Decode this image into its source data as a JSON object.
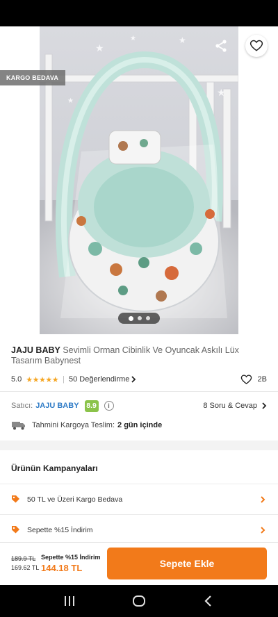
{
  "badges": {
    "cargo": "KARGO BEDAVA"
  },
  "gallery": {
    "image_count": 3,
    "active_index": 0
  },
  "product": {
    "brand": "JAJU BABY",
    "name": "Sevimli Orman Cibinlik Ve Oyuncak Askılı Lüx Tasarım Babynest",
    "rating": "5.0",
    "stars": "★★★★★",
    "reviews": "50 Değerlendirme",
    "likes": "2B"
  },
  "seller": {
    "label": "Satıcı:",
    "name": "JAJU BABY",
    "score": "8.9",
    "qa": "8 Soru & Cevap"
  },
  "delivery": {
    "label": "Tahmini Kargoya Teslim:",
    "days": "2 gün içinde"
  },
  "campaigns": {
    "title": "Ürünün Kampanyaları",
    "items": [
      {
        "label": "50 TL ve Üzeri Kargo Bedava"
      },
      {
        "label": "Sepette %15 İndirim"
      }
    ]
  },
  "pricing": {
    "old_price": "189.9 TL",
    "mid_price": "169.62 TL",
    "discount_label": "Sepette %15 İndirim",
    "final_price": "144.18 TL"
  },
  "actions": {
    "add_to_cart": "Sepete Ekle"
  },
  "colors": {
    "accent": "#f27a1a",
    "seller_link": "#2e7bc6",
    "score_badge": "#8bc34a",
    "star": "#f5a623"
  }
}
